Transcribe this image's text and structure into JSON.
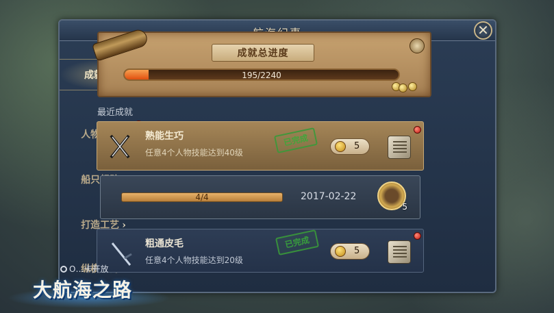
{
  "panel": {
    "title": "航海纪事",
    "close_icon": "close-icon"
  },
  "sidebar": {
    "items": [
      {
        "label": "成就总榜",
        "active": true,
        "has_dot": true
      },
      {
        "label": "人物成长",
        "active": false,
        "has_dot": true
      },
      {
        "label": "船只舰队",
        "active": false,
        "has_dot": false
      },
      {
        "label": "打造工艺",
        "active": false,
        "has_dot": false
      },
      {
        "label": "纵横四海",
        "active": false,
        "has_dot": false
      }
    ],
    "arrow": "›"
  },
  "progress": {
    "label": "成就总进度",
    "text": "195/2240",
    "fraction": 0.087
  },
  "section_label": "最近成就",
  "achievements": [
    {
      "name": "熟能生巧",
      "desc": "任意4个人物技能达到40级",
      "stamp": "已完成",
      "reward": "5"
    },
    {
      "name": "粗通皮毛",
      "desc": "任意4个人物技能达到20级",
      "stamp": "已完成",
      "reward": "5"
    }
  ],
  "detail": {
    "progress_text": "4/4",
    "date": "2017-02-22",
    "badge_count": "5"
  },
  "notice": "O…卡开放",
  "logo": "大航海之路",
  "colors": {
    "accent_gold": "#c7a874",
    "panel_blue": "#25354b",
    "progress_orange": "#e05010",
    "stamp_green": "#3aaa3a"
  }
}
